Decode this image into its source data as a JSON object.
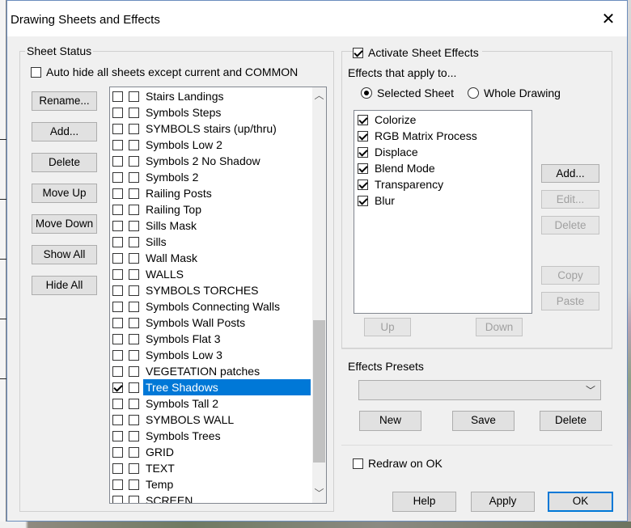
{
  "window": {
    "title": "Drawing Sheets and Effects",
    "close_glyph": "✕"
  },
  "sheet_status": {
    "legend": "Sheet Status",
    "auto_hide_label": "Auto hide all sheets except current and COMMON",
    "auto_hide_checked": false,
    "buttons": [
      "Rename...",
      "Add...",
      "Delete",
      "Move Up",
      "Move Down",
      "Show All",
      "Hide All"
    ],
    "sheets": [
      {
        "name": "Stairs Landings",
        "visible": false,
        "locked": false
      },
      {
        "name": "Symbols Steps",
        "visible": false,
        "locked": false
      },
      {
        "name": "SYMBOLS stairs (up/thru)",
        "visible": false,
        "locked": false
      },
      {
        "name": "Symbols Low 2",
        "visible": false,
        "locked": false
      },
      {
        "name": "Symbols 2 No Shadow",
        "visible": false,
        "locked": false
      },
      {
        "name": "Symbols 2",
        "visible": false,
        "locked": false
      },
      {
        "name": "Railing Posts",
        "visible": false,
        "locked": false
      },
      {
        "name": "Railing Top",
        "visible": false,
        "locked": false
      },
      {
        "name": "Sills Mask",
        "visible": false,
        "locked": false
      },
      {
        "name": "Sills",
        "visible": false,
        "locked": false
      },
      {
        "name": "Wall Mask",
        "visible": false,
        "locked": false
      },
      {
        "name": "WALLS",
        "visible": false,
        "locked": false
      },
      {
        "name": "SYMBOLS TORCHES",
        "visible": false,
        "locked": false
      },
      {
        "name": "Symbols Connecting Walls",
        "visible": false,
        "locked": false
      },
      {
        "name": "Symbols Wall Posts",
        "visible": false,
        "locked": false
      },
      {
        "name": "Symbols Flat 3",
        "visible": false,
        "locked": false
      },
      {
        "name": "Symbols Low 3",
        "visible": false,
        "locked": false
      },
      {
        "name": "VEGETATION patches",
        "visible": false,
        "locked": false
      },
      {
        "name": "Tree Shadows",
        "visible": true,
        "locked": false,
        "selected": true
      },
      {
        "name": "Symbols Tall 2",
        "visible": false,
        "locked": false
      },
      {
        "name": "SYMBOLS WALL",
        "visible": false,
        "locked": false
      },
      {
        "name": "Symbols Trees",
        "visible": false,
        "locked": false
      },
      {
        "name": "GRID",
        "visible": false,
        "locked": false
      },
      {
        "name": "TEXT",
        "visible": false,
        "locked": false
      },
      {
        "name": "Temp",
        "visible": false,
        "locked": false
      },
      {
        "name": "SCREEN",
        "visible": false,
        "locked": false
      }
    ]
  },
  "effects": {
    "activate_label": "Activate Sheet Effects",
    "activate_checked": true,
    "applies_to_label": "Effects that apply to...",
    "selected_sheet_label": "Selected Sheet",
    "whole_drawing_label": "Whole Drawing",
    "selected_option": "Selected Sheet",
    "items": [
      {
        "name": "Colorize",
        "checked": true
      },
      {
        "name": "RGB Matrix Process",
        "checked": true
      },
      {
        "name": "Displace",
        "checked": true
      },
      {
        "name": "Blend Mode",
        "checked": true
      },
      {
        "name": "Transparency",
        "checked": true
      },
      {
        "name": "Blur",
        "checked": true
      }
    ],
    "buttons": {
      "add": "Add...",
      "edit": "Edit...",
      "delete": "Delete",
      "copy": "Copy",
      "paste": "Paste",
      "up": "Up",
      "down": "Down"
    },
    "presets_label": "Effects Presets",
    "preset_selected": "",
    "preset_buttons": {
      "new": "New",
      "save": "Save",
      "delete": "Delete"
    },
    "redraw_label": "Redraw on OK",
    "redraw_checked": false
  },
  "footer": {
    "help": "Help",
    "apply": "Apply",
    "ok": "OK"
  },
  "colors": {
    "selection": "#0078d7",
    "dialog_bg": "#f0f0f0",
    "default_button_border": "#0078d7"
  }
}
